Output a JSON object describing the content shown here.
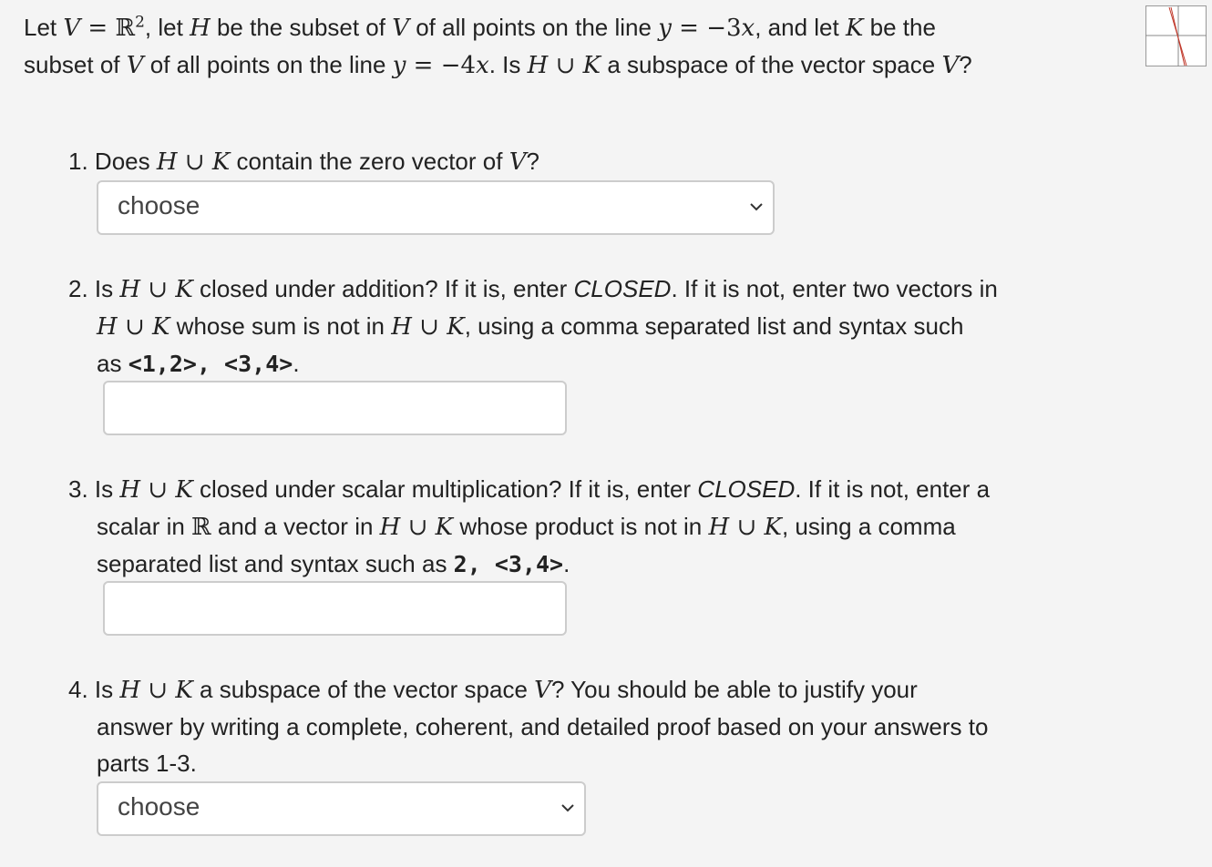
{
  "intro": {
    "line1_parts": [
      "Let ",
      "V",
      " = ",
      "ℝ",
      "2",
      ", let ",
      "H",
      " be the subset of ",
      "V",
      " of all points on the line ",
      "y",
      " = −3",
      "x",
      ", and let ",
      "K",
      " be the"
    ],
    "line2_parts": [
      "subset of ",
      "V",
      " of all points on the line ",
      "y",
      " = −4",
      "x",
      ". Is ",
      "H",
      " ∪ ",
      "K",
      " a subspace of the vector space ",
      "V",
      "?"
    ]
  },
  "questions": [
    {
      "number": "1.",
      "text_parts": [
        " Does ",
        "H",
        " ∪ ",
        "K",
        " contain the zero vector of ",
        "V",
        "?"
      ],
      "control": {
        "type": "select",
        "value": "choose"
      }
    },
    {
      "number": "2.",
      "line1": [
        " Is ",
        "H",
        " ∪ ",
        "K",
        " closed under addition? If it is, enter ",
        "CLOSED",
        ". If it is not, enter two vectors in"
      ],
      "line2": [
        "H",
        " ∪ ",
        "K",
        " whose sum is not in ",
        "H",
        " ∪ ",
        "K",
        ", using a comma separated list and syntax such"
      ],
      "line3": [
        "as ",
        "<1,2>, <3,4>",
        "."
      ],
      "control": {
        "type": "text",
        "value": ""
      }
    },
    {
      "number": "3.",
      "line1": [
        " Is ",
        "H",
        " ∪ ",
        "K",
        " closed under scalar multiplication? If it is, enter ",
        "CLOSED",
        ". If it is not, enter a"
      ],
      "line2": [
        "scalar in ",
        "ℝ",
        " and a vector in ",
        "H",
        " ∪ ",
        "K",
        " whose product is not in ",
        "H",
        " ∪ ",
        "K",
        ", using a comma"
      ],
      "line3": [
        "separated list and syntax such as ",
        "2, <3,4>",
        "."
      ],
      "control": {
        "type": "text",
        "value": ""
      }
    },
    {
      "number": "4.",
      "line1": [
        " Is ",
        "H",
        " ∪ ",
        "K",
        " a subspace of the vector space ",
        "V",
        "? You should be able to justify your"
      ],
      "line2": "answer by writing a complete, coherent, and detailed proof based on your answers to",
      "line3": "parts 1-3.",
      "control": {
        "type": "select",
        "value": "choose"
      }
    }
  ],
  "colors": {
    "background": "#f4f4f4",
    "text": "#222222",
    "border": "#cccccc",
    "graph_line": "#c0392b"
  }
}
